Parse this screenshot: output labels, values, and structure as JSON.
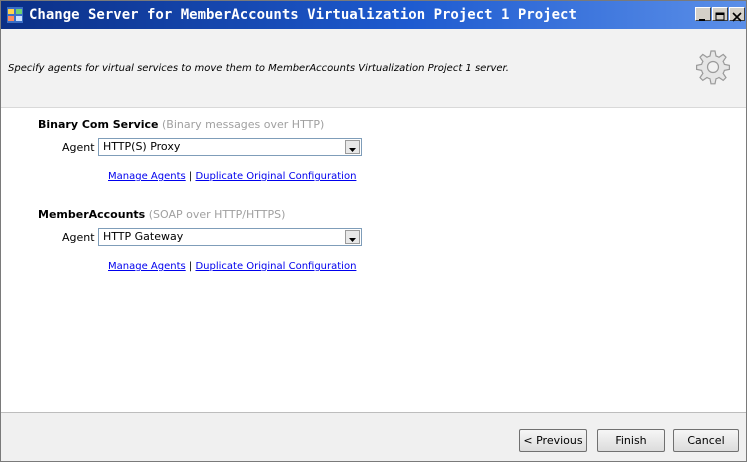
{
  "window": {
    "title": "Change Server for MemberAccounts Virtualization Project 1 Project"
  },
  "header": {
    "instruction": "Specify agents for virtual services to move them to MemberAccounts Virtualization Project 1 server.",
    "icon": "gear-icon"
  },
  "services": [
    {
      "name": "Binary Com Service",
      "protocol": "(Binary messages over HTTP)",
      "agent_label": "Agent",
      "agent_value": "HTTP(S) Proxy",
      "manage_link": "Manage Agents",
      "separator": "|",
      "duplicate_link": "Duplicate Original Configuration"
    },
    {
      "name": "MemberAccounts",
      "protocol": "(SOAP over HTTP/HTTPS)",
      "agent_label": "Agent",
      "agent_value": "HTTP Gateway",
      "manage_link": "Manage Agents",
      "separator": "|",
      "duplicate_link": "Duplicate Original Configuration"
    }
  ],
  "footer": {
    "previous": "< Previous",
    "finish": "Finish",
    "cancel": "Cancel"
  },
  "colors": {
    "link": "#0000ee",
    "protocol_text": "#a0a0a0",
    "title_bar": "#1e5bd0"
  }
}
